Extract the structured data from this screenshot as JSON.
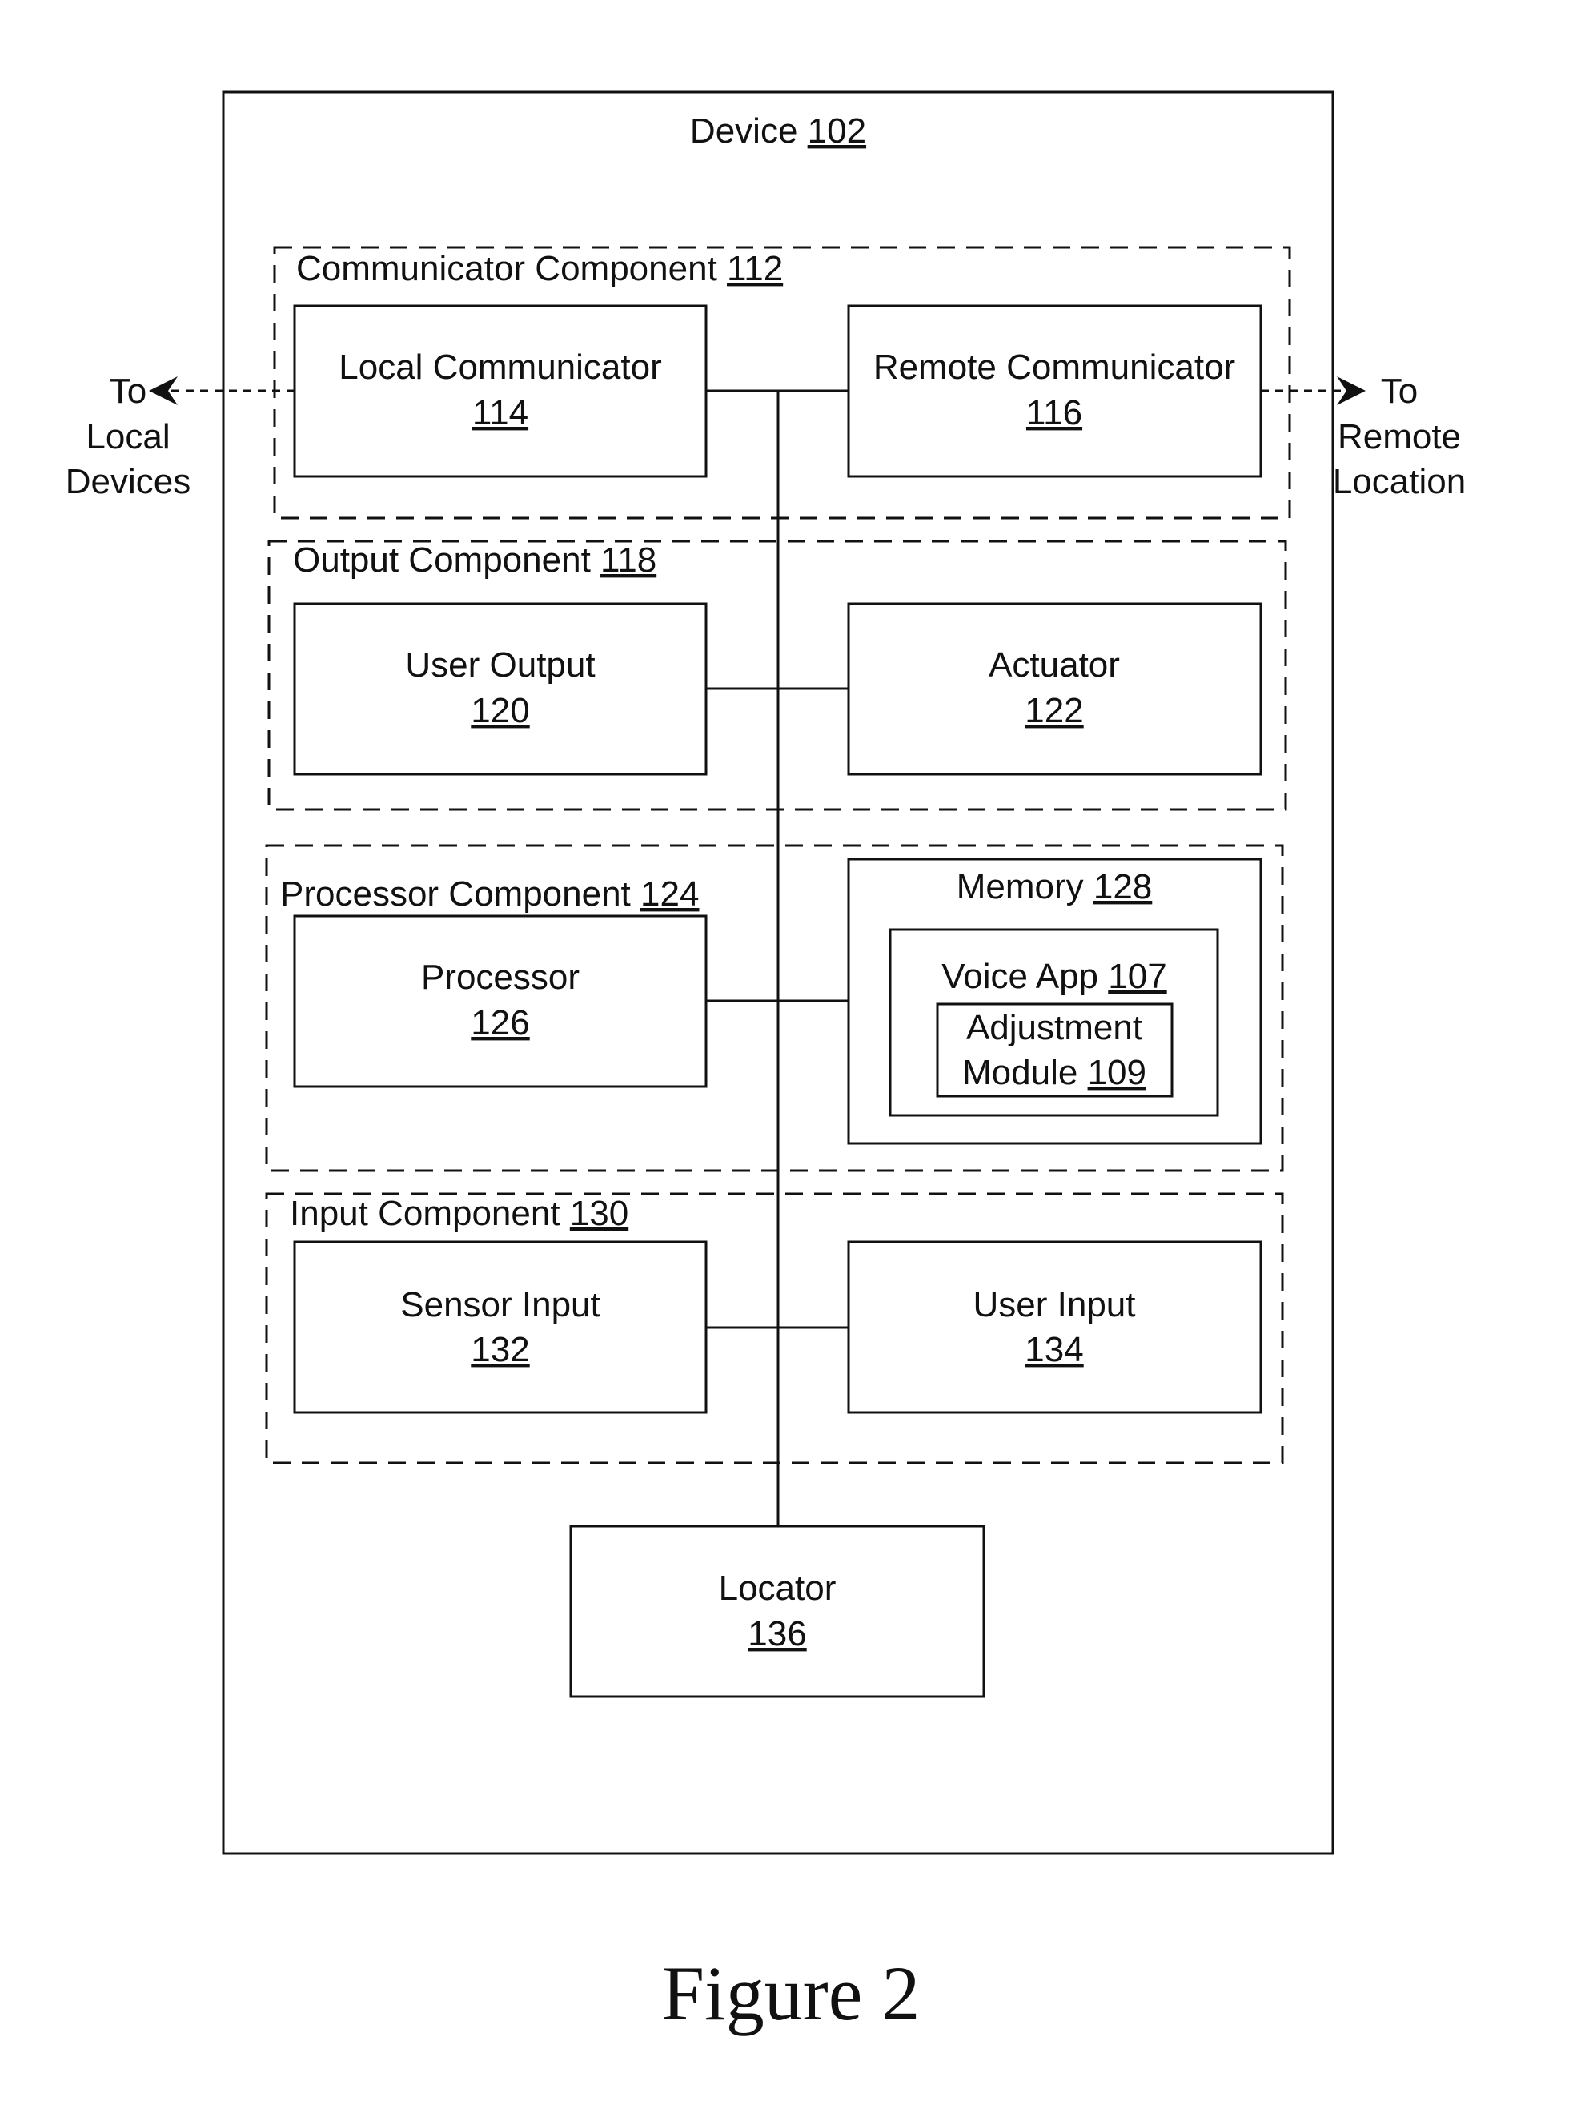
{
  "device": {
    "label": "Device",
    "ref": "102"
  },
  "external": {
    "left": [
      "To",
      "Local",
      "Devices"
    ],
    "right": [
      "To",
      "Remote",
      "Location"
    ]
  },
  "components": {
    "communicator": {
      "label": "Communicator Component",
      "ref": "112",
      "left": {
        "name": "Local Communicator",
        "ref": "114"
      },
      "right": {
        "name": "Remote Communicator",
        "ref": "116"
      }
    },
    "output": {
      "label": "Output Component",
      "ref": "118",
      "left": {
        "name": "User Output",
        "ref": "120"
      },
      "right": {
        "name": "Actuator",
        "ref": "122"
      }
    },
    "processor": {
      "label": "Processor Component",
      "ref": "124",
      "left": {
        "name": "Processor",
        "ref": "126"
      },
      "memory": {
        "label": "Memory",
        "ref": "128",
        "voice_app": {
          "label": "Voice App",
          "ref": "107",
          "module": {
            "line1": "Adjustment",
            "line2": "Module",
            "ref": "109"
          }
        }
      }
    },
    "input": {
      "label": "Input Component",
      "ref": "130",
      "left": {
        "name": "Sensor Input",
        "ref": "132"
      },
      "right": {
        "name": "User Input",
        "ref": "134"
      }
    }
  },
  "locator": {
    "name": "Locator",
    "ref": "136"
  },
  "caption": "Figure 2"
}
